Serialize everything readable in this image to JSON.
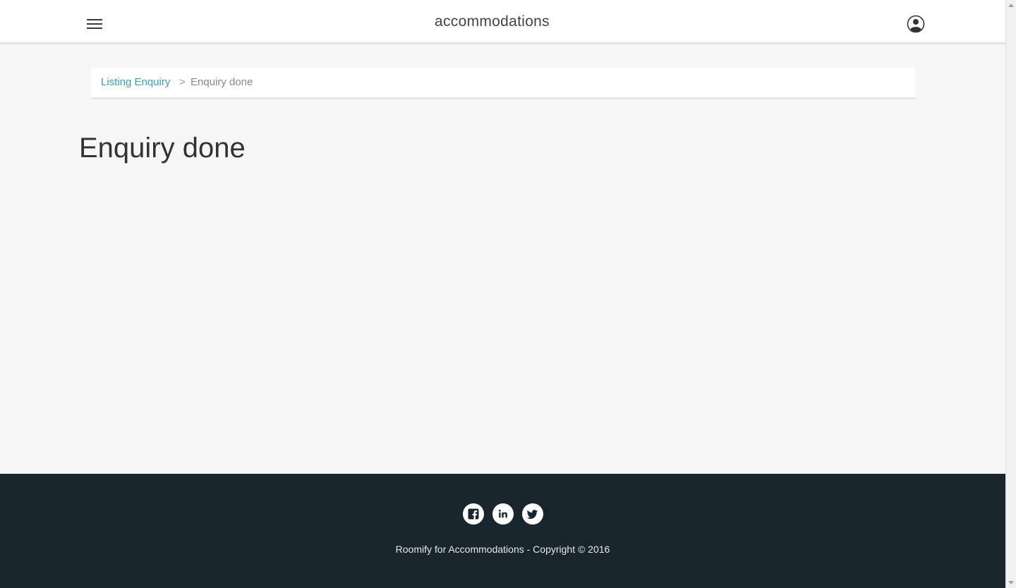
{
  "header": {
    "brand": "accommodations",
    "menu_icon": "hamburger-menu-icon",
    "user_icon": "user-account-icon"
  },
  "breadcrumb": {
    "link_label": "Listing Enquiry",
    "separator": ">",
    "current_label": "Enquiry done"
  },
  "main": {
    "title": "Enquiry done"
  },
  "footer": {
    "social": [
      {
        "icon": "facebook-icon"
      },
      {
        "icon": "linkedin-icon"
      },
      {
        "icon": "twitter-icon"
      }
    ],
    "copyright": "Roomify for Accommodations - Copyright © 2016"
  },
  "colors": {
    "accent_link": "#3a9cb0",
    "footer_bg": "#18252d",
    "page_bg": "#f7f7f7"
  }
}
